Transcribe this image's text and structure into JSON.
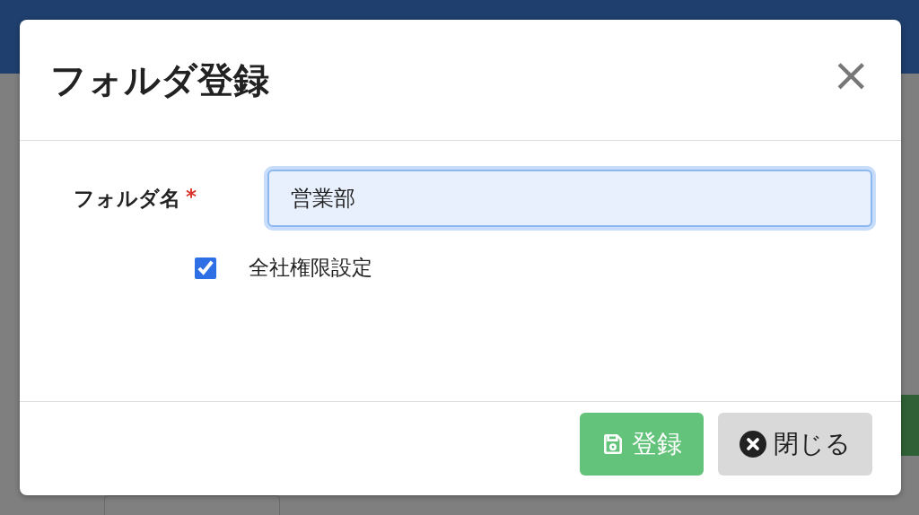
{
  "dialog": {
    "title": "フォルダ登録",
    "close_symbol": "×",
    "field": {
      "label": "フォルダ名",
      "required_mark": "*",
      "value": "営業部",
      "focused": true
    },
    "checkbox": {
      "label": "全社権限設定",
      "checked": true
    },
    "buttons": [
      {
        "kind": "primary",
        "label": "登録"
      },
      {
        "kind": "secondary",
        "label": "閉じる"
      }
    ]
  }
}
